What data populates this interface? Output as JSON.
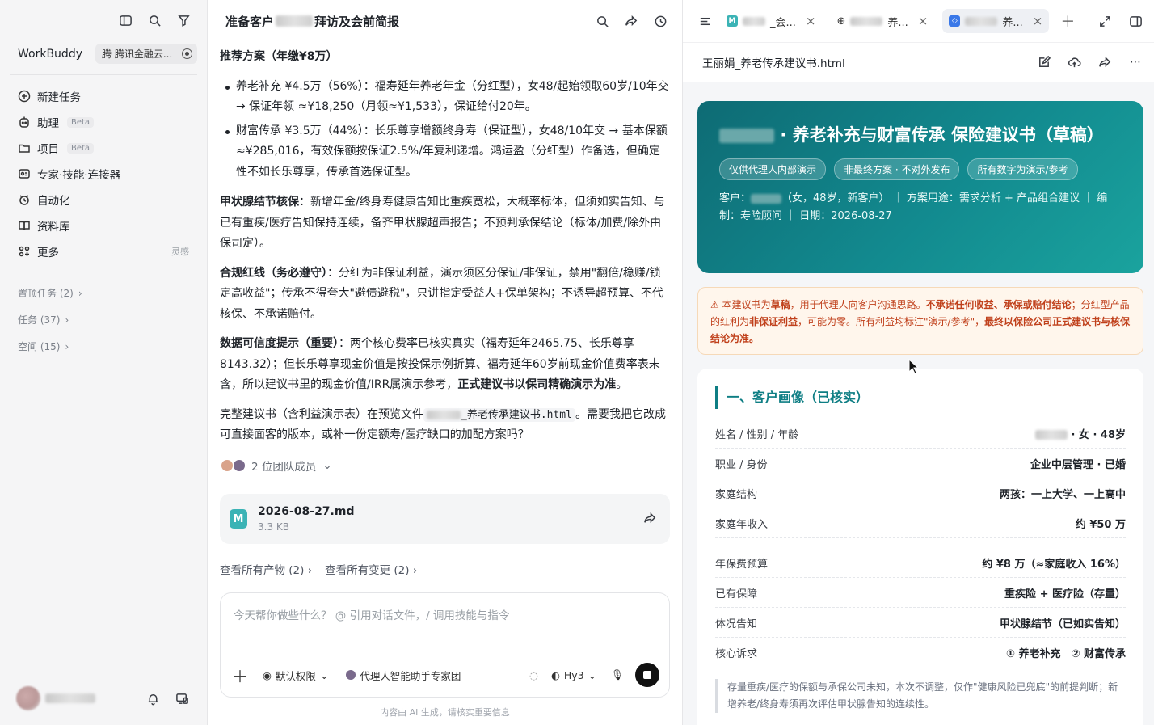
{
  "sidebar": {
    "brand": "WorkBuddy",
    "workspace": "腾 腾讯金融云...",
    "nav": [
      {
        "label": "新建任务",
        "badge": ""
      },
      {
        "label": "助理",
        "badge": "Beta"
      },
      {
        "label": "项目",
        "badge": "Beta"
      },
      {
        "label": "专家·技能·连接器",
        "badge": ""
      },
      {
        "label": "自动化",
        "badge": ""
      },
      {
        "label": "资料库",
        "badge": ""
      },
      {
        "label": "更多",
        "badge": "",
        "right": "灵感"
      }
    ],
    "groups": [
      {
        "label": "置顶任务 (2)"
      },
      {
        "label": "任务 (37)"
      },
      {
        "label": "空间 (15)"
      }
    ]
  },
  "chat": {
    "title_prefix": "准备客户",
    "title_suffix": "拜访及会前简报",
    "plan_heading": "推荐方案（年缴¥8万）",
    "bullet1": "养老补充 ¥4.5万（56%）：福寿延年养老年金（分红型），女48/起始领取60岁/10年交 → 保证年领 ≈¥18,250（月领≈¥1,533），保证给付20年。",
    "bullet2": "财富传承 ¥3.5万（44%）：长乐尊享增额终身寿（保证型），女48/10年交 → 基本保额≈¥285,016，有效保额按保证2.5%/年复利递增。鸿运盈（分红型）作备选，但确定性不如长乐尊享，传承首选保证型。",
    "thyroid_bold": "甲状腺结节核保",
    "thyroid_text": "：新增年金/终身寿健康告知比重疾宽松，大概率标体，但须如实告知、与已有重疾/医疗告知保持连续，备齐甲状腺超声报告；不预判承保结论（标体/加费/除外由保司定）。",
    "compliance_bold": "合规红线（务必遵守）",
    "compliance_text": "：分红为非保证利益，演示须区分保证/非保证，禁用\"翻倍/稳赚/锁定高收益\"；传承不得夸大\"避债避税\"，只讲指定受益人+保单架构；不诱导超预算、不代核保、不承诺赔付。",
    "data_bold": "数据可信度提示（重要）",
    "data_text": "：两个核心费率已核实真实（福寿延年2465.75、长乐尊享8143.32）；但长乐尊享现金价值是按投保示例折算、福寿延年60岁前现金价值费率表未含，所以建议书里的现金价值/IRR属演示参考，",
    "data_bold2": "正式建议书以保司精确演示为准",
    "data_end": "。",
    "final_text1": "完整建议书（含利益演示表）在预览文件",
    "final_code": "_养老传承建议书.html",
    "final_text2": "。需要我把它改成可直接面客的版本，或补一份定额寿/医疗缺口的加配方案吗？",
    "team_label": "2 位团队成员",
    "file_name": "2026-08-27.md",
    "file_size": "3.3 KB",
    "link_artifacts": "查看所有产物 (2)",
    "link_changes": "查看所有变更 (2)",
    "input_placeholder": "今天帮你做些什么？ @ 引用对话文件，/ 调用技能与指令",
    "tool_permission": "默认权限",
    "tool_expert": "代理人智能助手专家团",
    "tool_model": "Hy3",
    "disclaimer": "内容由 AI 生成，请核实重要信息"
  },
  "preview": {
    "tabs": [
      {
        "label": "_会...",
        "active": false
      },
      {
        "label": "养...",
        "active": false
      },
      {
        "label": "养...",
        "active": true
      }
    ],
    "file_title": "王丽娟_养老传承建议书.html",
    "hero_title": "· 养老补充与财富传承 保险建议书（草稿）",
    "pills": [
      "仅供代理人内部演示",
      "非最终方案 · 不对外发布",
      "所有数字为演示/参考"
    ],
    "meta_client": "客户：",
    "meta_rest": "（女，48岁，新客户） ｜ 方案用途：需求分析 + 产品组合建议 ｜ 编制：寿险顾问 ｜ 日期：2026-08-27",
    "warn_1": "⚠ 本建议书为",
    "warn_b1": "草稿",
    "warn_2": "，用于代理人向客户沟通思路。",
    "warn_b2": "不承诺任何收益、承保或赔付结论",
    "warn_3": "；分红型产品的红利为",
    "warn_b3": "非保证利益",
    "warn_4": "，可能为零。所有利益均标注\"演示/参考\"，",
    "warn_b4": "最终以保险公司正式建议书与核保结论为准。",
    "section_title": "一、客户画像（已核实）",
    "rows": [
      {
        "k": "姓名 / 性别 / 年龄",
        "v": "· 女 · 48岁"
      },
      {
        "k": "职业 / 身份",
        "v": "企业中层管理 · 已婚"
      },
      {
        "k": "家庭结构",
        "v": "两孩：一上大学、一上高中"
      },
      {
        "k": "家庭年收入",
        "v": "约 ¥50 万"
      },
      {
        "k": "年保费预算",
        "v": "约 ¥8 万（≈家庭收入 16%）"
      },
      {
        "k": "已有保障",
        "v": "重疾险 + 医疗险（存量）"
      },
      {
        "k": "体况告知",
        "v": "甲状腺结节（已如实告知）"
      },
      {
        "k": "核心诉求",
        "v": "① 养老补充　② 财富传承"
      }
    ],
    "note": "存量重疾/医疗的保额与承保公司未知，本次不调整，仅作\"健康风险已兜底\"的前提判断；新增养老/终身寿须再次评估甲状腺告知的连续性。"
  },
  "colors": {
    "accent": "#0e7e84",
    "warning": "#c0401b",
    "hero_gradient": "#128a8f"
  }
}
